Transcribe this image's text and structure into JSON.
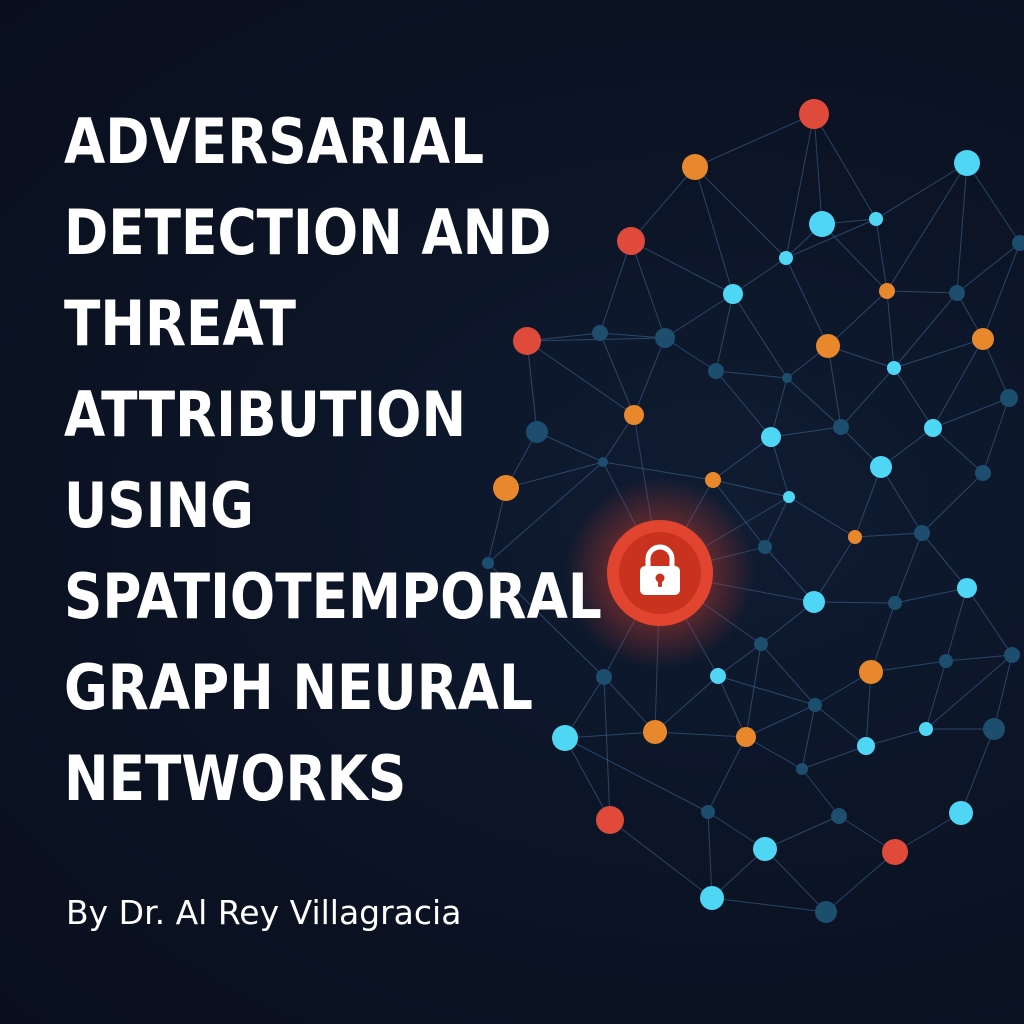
{
  "title": {
    "lines": [
      "ADVERSARIAL",
      "DETECTION AND",
      "THREAT",
      "ATTRIBUTION",
      "USING",
      "SPATIOTEMPORAL",
      "GRAPH NEURAL",
      "NETWORKS"
    ]
  },
  "byline": "By Dr. Al Rey Villagracia",
  "colors": {
    "background": "#0c1426",
    "text": "#ffffff",
    "node_red": "#e04a3a",
    "node_orange": "#e8872c",
    "node_cyan": "#4fd6f5",
    "node_dark": "#1d4e6e",
    "edge": "#3f6f9a",
    "lock_badge": "#d8392b"
  },
  "icons": {
    "center": "lock-icon"
  }
}
